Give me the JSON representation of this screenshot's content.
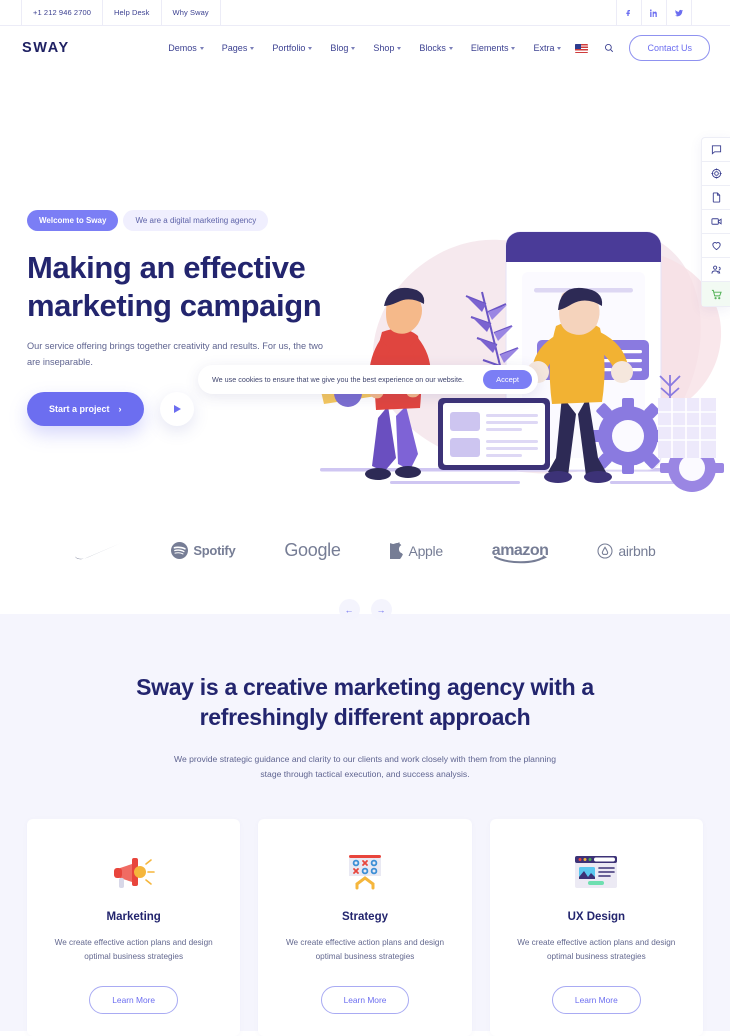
{
  "topbar": {
    "phone": "+1 212 946 2700",
    "links": [
      "Help Desk",
      "Why Sway"
    ],
    "socials": [
      "facebook-icon",
      "linkedin-icon",
      "twitter-icon"
    ]
  },
  "header": {
    "logo": "SWAY",
    "nav": [
      {
        "label": "Demos",
        "has_dropdown": true
      },
      {
        "label": "Pages",
        "has_dropdown": true
      },
      {
        "label": "Portfolio",
        "has_dropdown": true
      },
      {
        "label": "Blog",
        "has_dropdown": true
      },
      {
        "label": "Shop",
        "has_dropdown": true
      },
      {
        "label": "Blocks",
        "has_dropdown": true
      },
      {
        "label": "Elements",
        "has_dropdown": true
      },
      {
        "label": "Extra",
        "has_dropdown": true
      }
    ],
    "language_flag": "us-flag-icon",
    "search_icon": "search-icon",
    "contact_label": "Contact Us"
  },
  "hero": {
    "badge_primary": "Welcome to Sway",
    "badge_secondary": "We are a digital marketing agency",
    "title": "Making an effective marketing campaign",
    "subtitle": "Our service offering brings together creativity and results. For us, the two are inseparable.",
    "cta_label": "Start a project",
    "cta_arrow": "›",
    "play_icon": "play-icon"
  },
  "cookie": {
    "message": "We use cookies to ensure that we give you the best experience on our website.",
    "accept_label": "Accept"
  },
  "brands": [
    {
      "name": "nike-logo",
      "type": "icon",
      "label": ""
    },
    {
      "name": "spotify-logo",
      "type": "icon-word",
      "label": "Spotify"
    },
    {
      "name": "google-logo",
      "type": "word",
      "label": "Google"
    },
    {
      "name": "apple-logo",
      "type": "icon-word",
      "label": "Apple"
    },
    {
      "name": "amazon-logo",
      "type": "word",
      "label": "amazon"
    },
    {
      "name": "airbnb-logo",
      "type": "icon-word",
      "label": "airbnb"
    }
  ],
  "carousel": {
    "prev_icon": "arrow-left-icon",
    "next_icon": "arrow-right-icon",
    "prev_glyph": "←",
    "next_glyph": "→"
  },
  "side_tools": [
    {
      "name": "chat-icon"
    },
    {
      "name": "target-icon"
    },
    {
      "name": "document-icon"
    },
    {
      "name": "video-icon"
    },
    {
      "name": "heart-icon"
    },
    {
      "name": "users-icon"
    },
    {
      "name": "cart-icon"
    }
  ],
  "services": {
    "title": "Sway is a creative marketing agency with a refreshingly different approach",
    "subtitle": "We provide strategic guidance and clarity to our clients and work closely with them from the planning stage through tactical execution, and success analysis.",
    "cards": [
      {
        "icon": "megaphone-icon",
        "title": "Marketing",
        "desc": "We create effective action plans and design optimal business strategies",
        "button": "Learn More"
      },
      {
        "icon": "tactics-board-icon",
        "title": "Strategy",
        "desc": "We create effective action plans and design optimal business strategies",
        "button": "Learn More"
      },
      {
        "icon": "browser-window-icon",
        "title": "UX Design",
        "desc": "We create effective action plans and design optimal business strategies",
        "button": "Learn More"
      }
    ]
  },
  "colors": {
    "primary": "#6c6ef0",
    "dark_navy": "#23256e",
    "section_bg": "#f5f5fd",
    "accent_green": "#4caf50"
  }
}
